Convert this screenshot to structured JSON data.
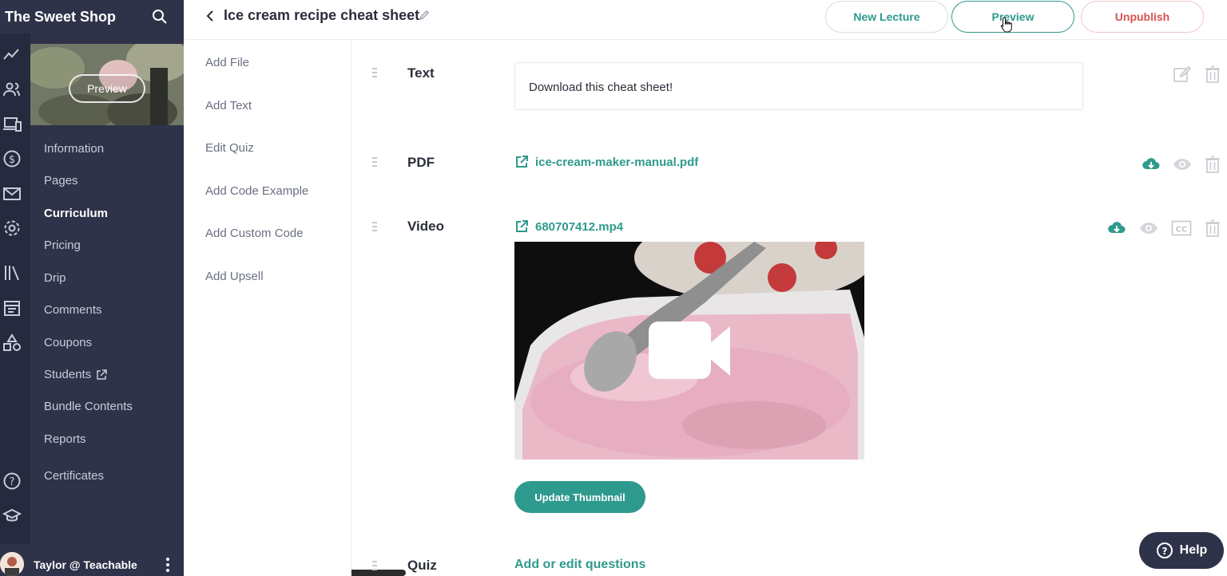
{
  "sidebar": {
    "school_name": "The Sweet Shop",
    "thumbnail_preview_label": "Preview",
    "nav": [
      "Information",
      "Pages",
      "Curriculum",
      "Pricing",
      "Drip",
      "Comments",
      "Coupons",
      "Students",
      "Bundle Contents",
      "Reports",
      "Certificates"
    ],
    "active_nav": "Curriculum",
    "rail_icons": [
      "analytics-icon",
      "users-icon",
      "devices-icon",
      "dollar-icon",
      "mail-icon",
      "settings-icon",
      "library-icon",
      "calendar-icon",
      "shapes-icon",
      "help-circle-icon",
      "graduation-cap-icon"
    ],
    "user_name": "Taylor @ Teachable"
  },
  "header": {
    "title": "Ice cream recipe cheat sheet",
    "new_lecture": "New Lecture",
    "preview": "Preview",
    "unpublish": "Unpublish"
  },
  "add_menu": [
    "Add File",
    "Add Text",
    "Edit Quiz",
    "Add Code Example",
    "Add Custom Code",
    "Add Upsell"
  ],
  "content": {
    "text_label": "Text",
    "text_value": "Download this cheat sheet!",
    "pdf_label": "PDF",
    "pdf_file": "ice-cream-maker-manual.pdf",
    "video_label": "Video",
    "video_file": "680707412.mp4",
    "update_thumbnail": "Update Thumbnail",
    "quiz_label": "Quiz",
    "quiz_link": "Add or edit questions"
  },
  "help_label": "Help",
  "colors": {
    "accent": "#2e9a8d",
    "sidebar": "#2f3349",
    "danger": "#d9534f"
  }
}
